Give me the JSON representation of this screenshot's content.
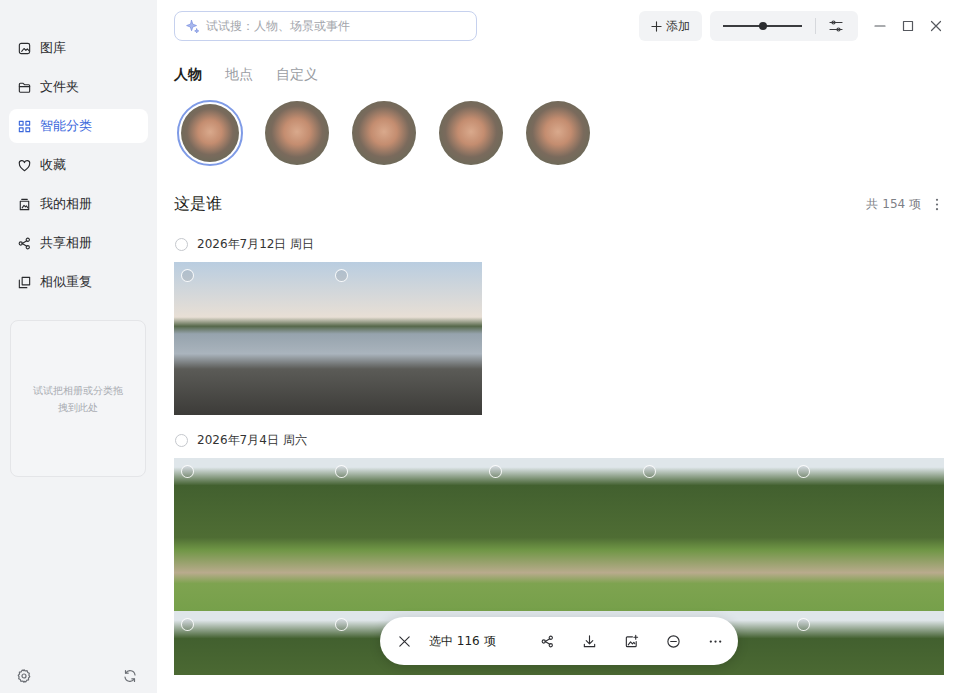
{
  "sidebar": {
    "items": [
      {
        "label": "图库",
        "selected": false
      },
      {
        "label": "文件夹",
        "selected": false
      },
      {
        "label": "智能分类",
        "selected": true
      },
      {
        "label": "收藏",
        "selected": false
      },
      {
        "label": "我的相册",
        "selected": false
      },
      {
        "label": "共享相册",
        "selected": false
      },
      {
        "label": "相似重复",
        "selected": false
      }
    ],
    "drop_hint": "试试把相册或分类拖拽到此处"
  },
  "search": {
    "placeholder": "试试搜：人物、场景或事件"
  },
  "add_button": {
    "label": "添加"
  },
  "zoom": {
    "level": 0.5
  },
  "tabs": [
    {
      "label": "人物",
      "selected": true
    },
    {
      "label": "地点",
      "selected": false
    },
    {
      "label": "自定义",
      "selected": false
    }
  ],
  "people": [
    {
      "selected": true
    },
    {
      "selected": false
    },
    {
      "selected": false
    },
    {
      "selected": false
    },
    {
      "selected": false
    }
  ],
  "section": {
    "title": "这是谁",
    "count": "共 154 项"
  },
  "groups": [
    {
      "date": "2026年7月12日 周日",
      "selected": false,
      "photos": [
        {
          "kind": "lake",
          "selected": false
        },
        {
          "kind": "lake",
          "selected": false
        }
      ]
    },
    {
      "date": "2026年7月4日 周六",
      "selected": false,
      "photos": [
        {
          "kind": "avenue",
          "selected": false
        },
        {
          "kind": "avenue",
          "selected": false
        },
        {
          "kind": "avenue",
          "selected": false
        },
        {
          "kind": "avenue",
          "selected": false
        },
        {
          "kind": "avenue",
          "selected": false
        },
        {
          "kind": "avenue",
          "selected": false
        },
        {
          "kind": "avenue",
          "selected": false
        },
        {
          "kind": "avenue",
          "selected": false
        },
        {
          "kind": "avenue",
          "selected": false
        },
        {
          "kind": "avenue",
          "selected": false
        }
      ]
    }
  ],
  "selection_bar": {
    "label": "选中 116 项"
  }
}
